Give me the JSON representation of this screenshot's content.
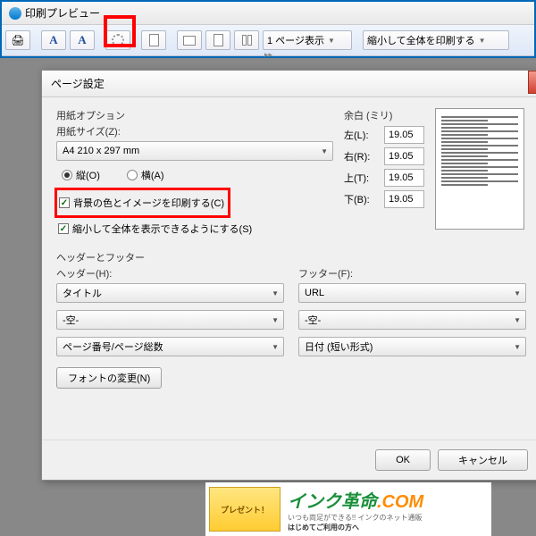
{
  "window": {
    "title": "印刷プレビュー"
  },
  "toolbar": {
    "page_display": "1 ページ表示",
    "shrink_fit": "縮小して全体を印刷する"
  },
  "dialog": {
    "title": "ページ設定",
    "paper": {
      "group": "用紙オプション",
      "size_label": "用紙サイズ(Z):",
      "size_value": "A4 210 x 297 mm",
      "portrait": "縦(O)",
      "landscape": "横(A)",
      "print_bg": "背景の色とイメージを印刷する(C)",
      "shrink_fit": "縮小して全体を表示できるようにする(S)"
    },
    "margins": {
      "group": "余白 (ミリ)",
      "left_label": "左(L):",
      "left": "19.05",
      "right_label": "右(R):",
      "right": "19.05",
      "top_label": "上(T):",
      "top": "19.05",
      "bottom_label": "下(B):",
      "bottom": "19.05"
    },
    "hf": {
      "group": "ヘッダーとフッター",
      "header_label": "ヘッダー(H):",
      "footer_label": "フッター(F):",
      "h1": "タイトル",
      "f1": "URL",
      "h2": "-空-",
      "f2": "-空-",
      "h3": "ページ番号/ページ総数",
      "f3": "日付 (短い形式)",
      "font_btn": "フォントの変更(N)"
    },
    "ok": "OK",
    "cancel": "キャンセル"
  },
  "banner": {
    "present": "プレゼント！",
    "logo1": "インク革命",
    "logo2": ".COM"
  }
}
